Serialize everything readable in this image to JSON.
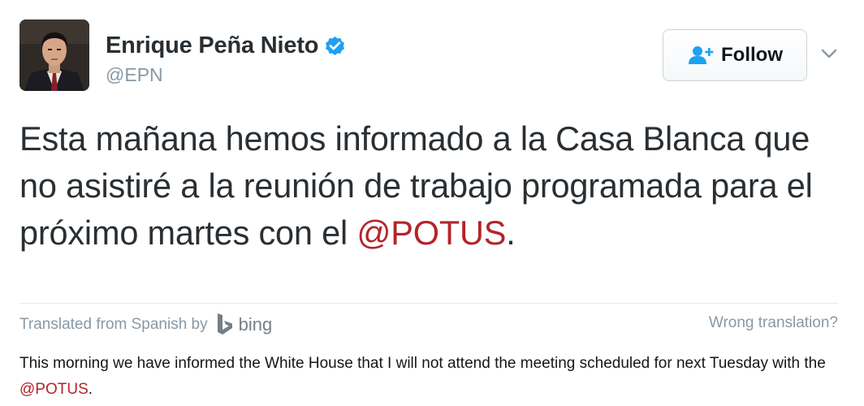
{
  "profile": {
    "display_name": "Enrique Peña Nieto",
    "handle": "@EPN",
    "verified": true,
    "avatar_icon": "profile-photo"
  },
  "follow": {
    "label": "Follow",
    "icon": "add-user-icon"
  },
  "tweet": {
    "text_before": "Esta mañana hemos informado a la Casa Blanca que no asistiré a la reunión de trabajo programada para el próximo martes con el ",
    "mention": "@POTUS",
    "text_after": "."
  },
  "translation": {
    "attribution": "Translated from Spanish by",
    "provider": "bing",
    "wrong_label": "Wrong translation?",
    "text_before": "This morning we have informed the White House that I will not attend the meeting scheduled for next Tuesday with the ",
    "mention": "@POTUS",
    "text_after": "."
  },
  "colors": {
    "mention": "#b4242a",
    "verified_badge": "#1da1f2",
    "follow_icon": "#1da1f2",
    "secondary_text": "#8899a6"
  }
}
